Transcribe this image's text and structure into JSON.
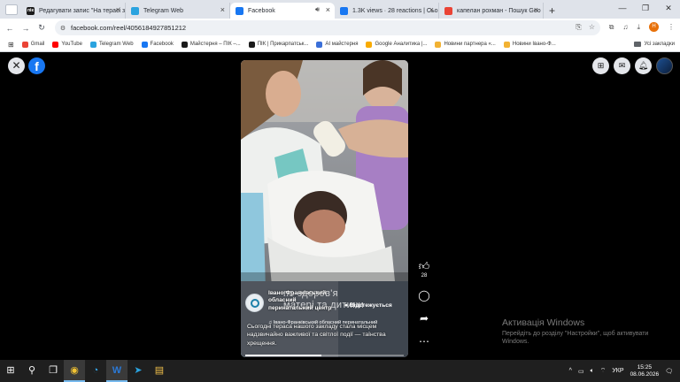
{
  "browser": {
    "tabs": [
      {
        "label": "Редагувати запис \"На терасі з",
        "icon": "пік",
        "color": "#1b1b1b",
        "active": false
      },
      {
        "label": "Telegram Web",
        "icon": "telegram-icon",
        "color": "#2aa3df",
        "active": false
      },
      {
        "label": "Facebook",
        "icon": "facebook-icon",
        "color": "#1877f2",
        "active": true
      },
      {
        "label": "1.3K views · 28 reactions | Сьо",
        "icon": "facebook-icon",
        "color": "#1877f2",
        "active": false
      },
      {
        "label": "капелан рохман - Пошук Goo",
        "icon": "google-icon",
        "color": "#ea4335",
        "active": false
      }
    ],
    "url": "facebook.com/reel/4056184927851212",
    "bookmarks": [
      {
        "label": "Gmail",
        "color": "#ea4335"
      },
      {
        "label": "YouTube",
        "color": "#ff0000"
      },
      {
        "label": "Telegram Web",
        "color": "#2aa3df"
      },
      {
        "label": "Facebook",
        "color": "#1877f2"
      },
      {
        "label": "Майстерня – ПІК –...",
        "color": "#1b1b1b"
      },
      {
        "label": "ПІК | Прикарпатськ...",
        "color": "#1b1b1b"
      },
      {
        "label": "AI майстерня",
        "color": "#3b6fd8"
      },
      {
        "label": "Google Аналитика |...",
        "color": "#f9ab00"
      },
      {
        "label": "Новини партнера «...",
        "color": "#f2b233"
      },
      {
        "label": "Новини Івано-Ф...",
        "color": "#f2b233"
      }
    ],
    "bookmarks_folder": "Усі закладки",
    "profile_initial": "Н"
  },
  "reel": {
    "overlay_text": "по здоров'я\nматері та дитини",
    "author": "Івано-Франківський обласний перинатальний центр",
    "follow_label": "Відстежується",
    "audio": "Івано-Франківський обласний перинатальний",
    "caption": "Сьогодні тераса нашого закладу стала місцем надзвичайно важливої та світлої події — таїнства хрещення.",
    "progress": 0.48,
    "like_count": "28"
  },
  "watermark": {
    "title": "Активація Windows",
    "text": "Перейдіть до розділу \"Настройки\", щоб активувати Windows."
  },
  "taskbar": {
    "language": "УКР",
    "time": "15:25",
    "date": "08.06.2026"
  }
}
